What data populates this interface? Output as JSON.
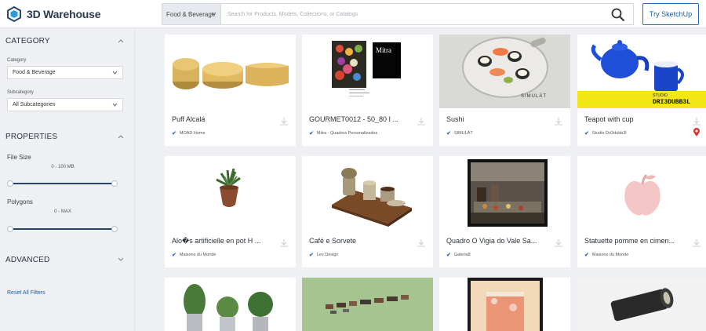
{
  "header": {
    "logo_text": "3D Warehouse",
    "category_select": "Food & Beverage",
    "search_placeholder": "Search for Products, Models, Collections, or Catalogs",
    "try_button": "Try SketchUp"
  },
  "sidebar": {
    "category_title": "CATEGORY",
    "category_label": "Category",
    "category_value": "Food & Beverage",
    "subcategory_label": "Subcategory",
    "subcategory_value": "All Subcategories",
    "properties_title": "PROPERTIES",
    "file_size_label": "File Size",
    "file_size_range": "0 - 100 MB",
    "polygons_label": "Polygons",
    "polygons_range": "0 - MAX",
    "advanced_title": "ADVANCED",
    "reset_label": "Reset All Filters"
  },
  "cards": [
    {
      "title": "Puff Alcalá",
      "author": "MOAD Home"
    },
    {
      "title": "GOURMET0012 - 50_80 I ...",
      "author": "Mitra - Quadros Personalizados"
    },
    {
      "title": "Sushi",
      "author": "SIMULÄT"
    },
    {
      "title": "Teapot with cup",
      "author": "Studio Dri3dubb3l"
    },
    {
      "title": "Alo�s artificielle en pot H ...",
      "author": "Maisons du Monde"
    },
    {
      "title": "Café e Sorvete",
      "author": "Lev Design"
    },
    {
      "title": "Quadro O Vigia do Vale Sa...",
      "author": "Galeria8"
    },
    {
      "title": "Statuette pomme en cimen...",
      "author": "Maisons du Monde"
    }
  ],
  "image_text": {
    "mitra": "Mitra",
    "simulat": "SIMULÄT",
    "studio": "STUDIO",
    "dri3dubb3l": "DRI3DUBB3L"
  },
  "colors": {
    "accent": "#2a6fb5",
    "slider": "#24466b",
    "background": "#eef0f3",
    "pin": "#d23a2f"
  }
}
